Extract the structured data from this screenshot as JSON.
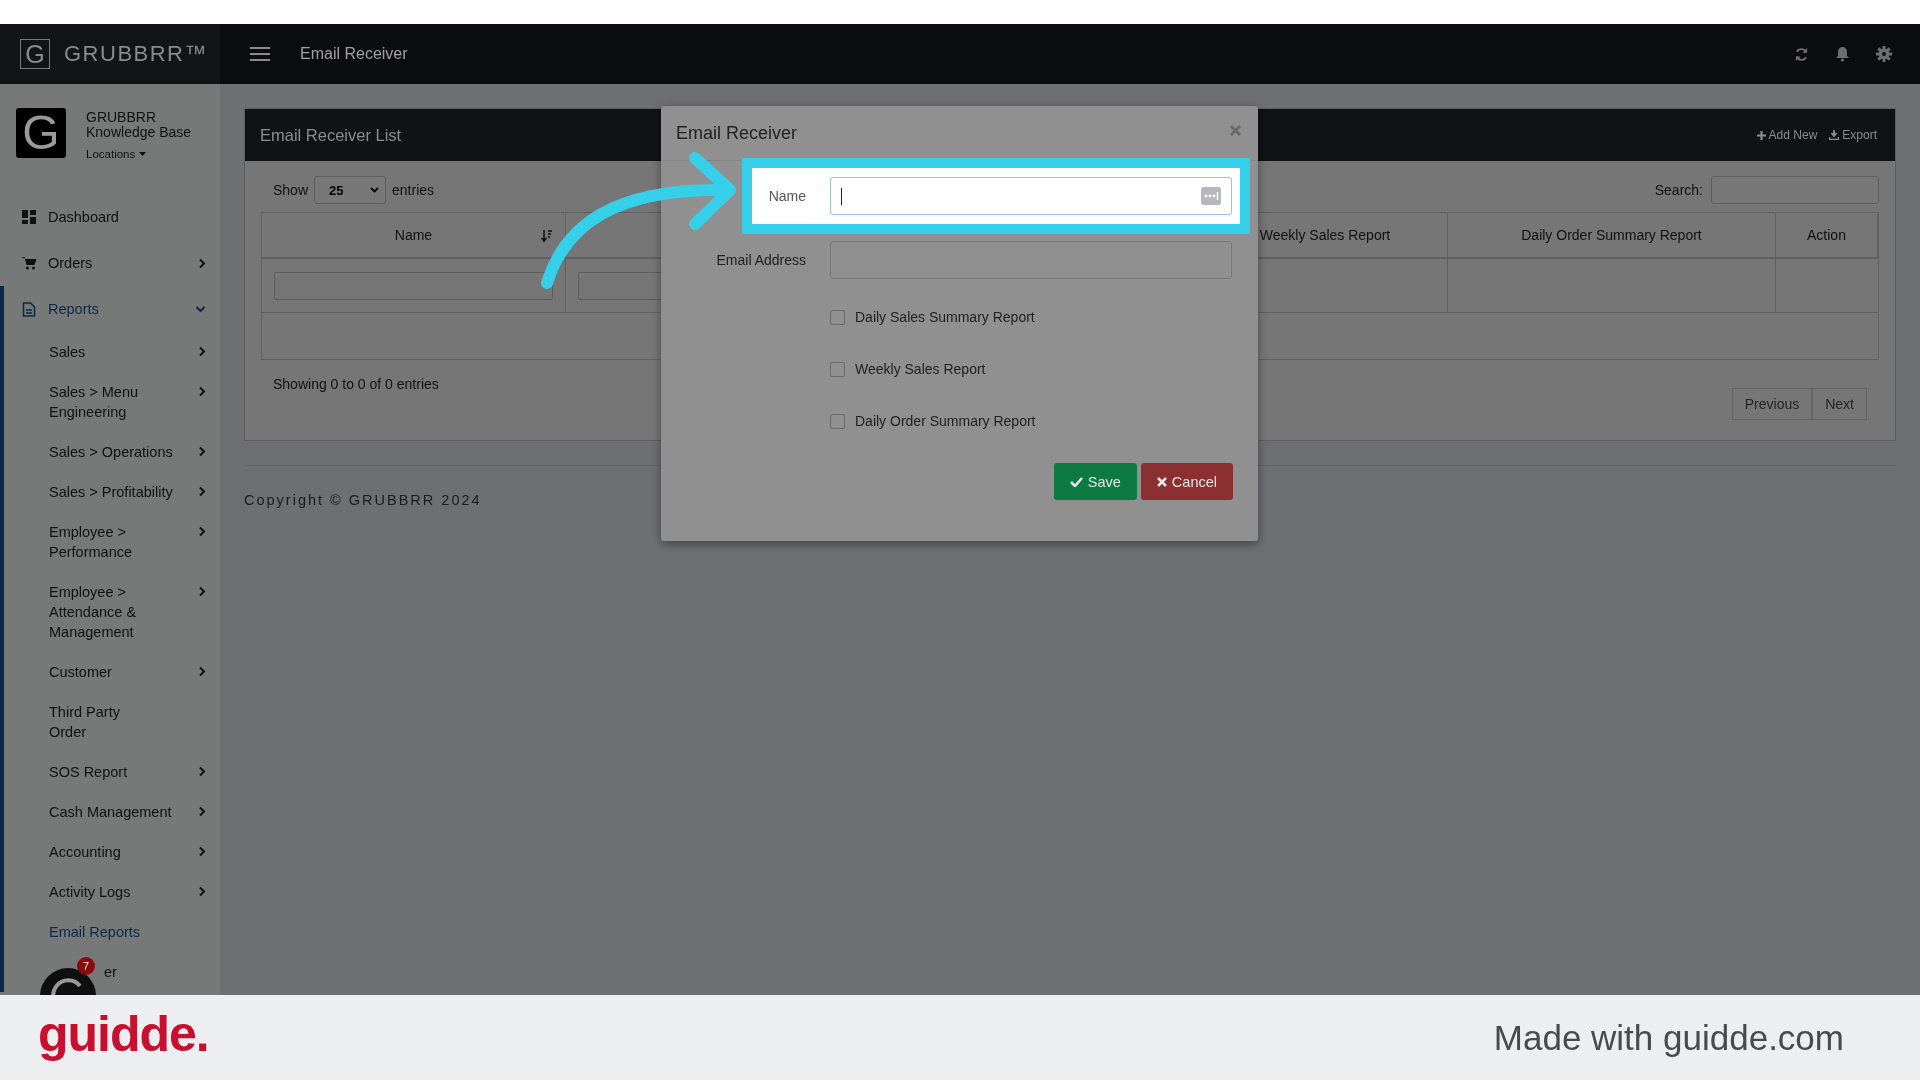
{
  "topbar": {
    "brand_letter": "G",
    "brand": "GRUBBRR™",
    "title": "Email Receiver"
  },
  "profile": {
    "logo": "G",
    "name": "GRUBBRR\nKnowledge Base",
    "locations": "Locations"
  },
  "nav": [
    {
      "label": "Dashboard",
      "selected": false,
      "expandable": false
    },
    {
      "label": "Orders",
      "selected": false,
      "expandable": true,
      "expanded": false
    },
    {
      "label": "Reports",
      "selected": true,
      "expandable": true,
      "expanded": true,
      "children": [
        {
          "label": "Sales",
          "selected": false,
          "expandable": true
        },
        {
          "label": "Sales > Menu\nEngineering",
          "selected": false,
          "expandable": true
        },
        {
          "label": "Sales > Operations",
          "selected": false,
          "expandable": true
        },
        {
          "label": "Sales > Profitability",
          "selected": false,
          "expandable": true
        },
        {
          "label": "Employee >\nPerformance",
          "selected": false,
          "expandable": true
        },
        {
          "label": "Employee >\nAttendance &\nManagement",
          "selected": false,
          "expandable": true
        },
        {
          "label": "Customer",
          "selected": false,
          "expandable": true
        },
        {
          "label": "Third Party\nOrder",
          "selected": false,
          "expandable": false
        },
        {
          "label": "SOS Report",
          "selected": false,
          "expandable": true
        },
        {
          "label": "Cash Management",
          "selected": false,
          "expandable": true
        },
        {
          "label": "Accounting",
          "selected": false,
          "expandable": true
        },
        {
          "label": "Activity Logs",
          "selected": false,
          "expandable": true
        },
        {
          "label": "Email Reports",
          "selected": true,
          "expandable": false
        },
        {
          "label": "er",
          "selected": false,
          "expandable": false,
          "kind": "covered"
        }
      ]
    }
  ],
  "chat_widget": {
    "badge": "7"
  },
  "panel": {
    "title": "Email Receiver List",
    "actions": [
      {
        "label": "Add New"
      },
      {
        "label": "Export"
      }
    ],
    "show_label": "Show",
    "page_size": "25",
    "entries_label": "entries",
    "search_label": "Search:",
    "table": {
      "columns": [
        {
          "label": "Name",
          "sortable": true
        },
        {
          "label": "Weekly Sales Report",
          "sortable": false
        },
        {
          "label": "Daily Order Summary Report",
          "sortable": false
        },
        {
          "label": "Action",
          "sortable": false
        }
      ]
    },
    "info": "Showing 0 to 0 of 0 entries",
    "pagination": [
      {
        "label": "Previous",
        "disabled": true
      },
      {
        "label": "Next",
        "disabled": true
      }
    ]
  },
  "copyright": "Copyright © GRUBBRR 2024",
  "modal": {
    "title": "Email Receiver",
    "fields": [
      {
        "label": "Name",
        "highlighted": true,
        "focused": true
      },
      {
        "label": "Email Address",
        "highlighted": false,
        "focused": false
      }
    ],
    "checkboxes": [
      {
        "label": "Daily Sales Summary Report",
        "checked": false
      },
      {
        "label": "Weekly Sales Report",
        "checked": false
      },
      {
        "label": "Daily Order Summary Report",
        "checked": false
      }
    ],
    "buttons": [
      {
        "label": "Save",
        "kind": "save"
      },
      {
        "label": "Cancel",
        "kind": "cancel"
      }
    ]
  },
  "footer": {
    "logo": "guidde.",
    "tagline": "Made with guidde.com"
  }
}
